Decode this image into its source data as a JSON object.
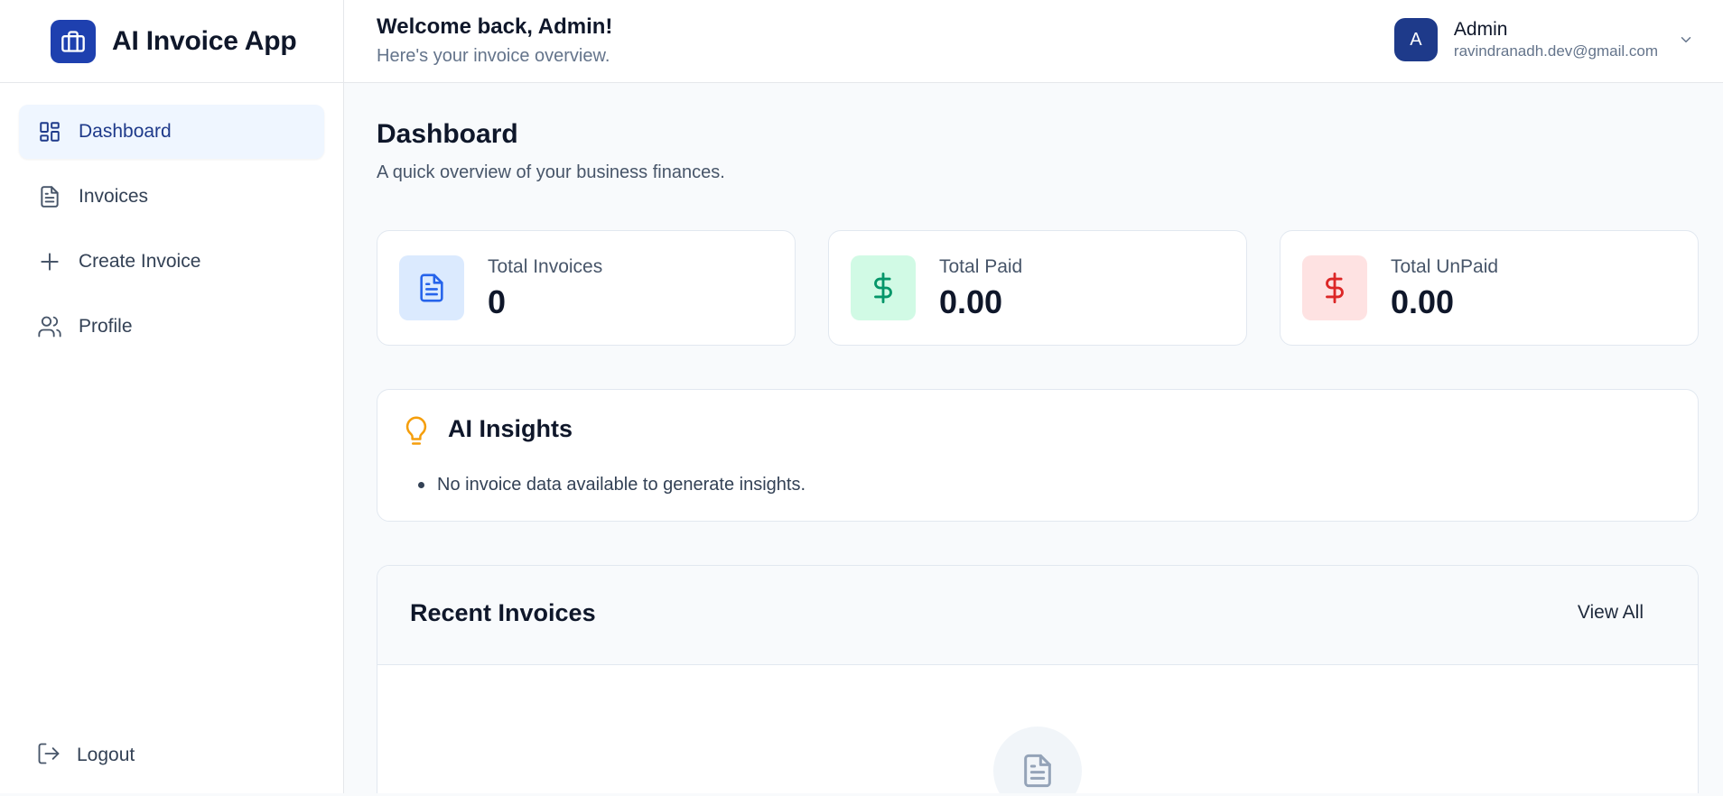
{
  "brand": {
    "title": "AI Invoice App",
    "icon": "briefcase-icon",
    "color": "#1e40af"
  },
  "sidebar": {
    "items": [
      {
        "label": "Dashboard",
        "icon": "dashboard-icon",
        "active": true
      },
      {
        "label": "Invoices",
        "icon": "document-icon",
        "active": false
      },
      {
        "label": "Create Invoice",
        "icon": "plus-icon",
        "active": false
      },
      {
        "label": "Profile",
        "icon": "users-icon",
        "active": false
      }
    ],
    "logout": {
      "label": "Logout",
      "icon": "logout-icon"
    }
  },
  "header": {
    "welcome": "Welcome back, Admin!",
    "subtitle": "Here's your invoice overview.",
    "user": {
      "initial": "A",
      "name": "Admin",
      "email": "ravindranadh.dev@gmail.com"
    }
  },
  "main": {
    "title": "Dashboard",
    "subtitle": "A quick overview of your business finances.",
    "stats": [
      {
        "label": "Total Invoices",
        "value": "0",
        "icon": "document-icon",
        "color": "#2563eb",
        "bg": "#dbeafe"
      },
      {
        "label": "Total Paid",
        "value": "0.00",
        "icon": "dollar-icon",
        "color": "#059669",
        "bg": "#d1fae5"
      },
      {
        "label": "Total UnPaid",
        "value": "0.00",
        "icon": "dollar-icon",
        "color": "#dc2626",
        "bg": "#fee2e2"
      }
    ],
    "insights": {
      "title": "AI Insights",
      "icon": "lightbulb-icon",
      "items": [
        "No invoice data available to generate insights."
      ]
    },
    "recent": {
      "title": "Recent Invoices",
      "view_all": "View All",
      "empty_icon": "document-icon"
    }
  }
}
